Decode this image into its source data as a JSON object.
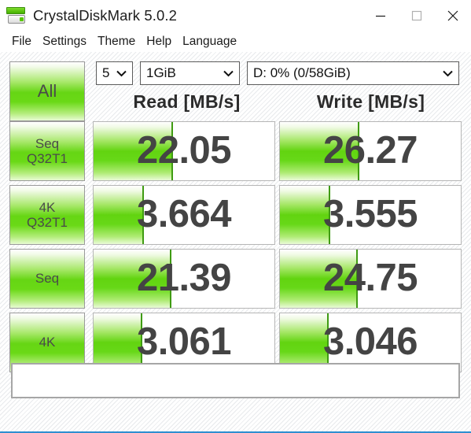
{
  "window": {
    "title": "CrystalDiskMark 5.0.2",
    "icon": "disk-icon",
    "controls": {
      "minimize": "minimize-icon",
      "maximize": "maximize-icon",
      "close": "close-icon"
    }
  },
  "menu": {
    "items": [
      {
        "label": "File"
      },
      {
        "label": "Settings"
      },
      {
        "label": "Theme"
      },
      {
        "label": "Help"
      },
      {
        "label": "Language"
      }
    ]
  },
  "settings": {
    "run_count": "5",
    "test_size": "1GiB",
    "drive": "D: 0% (0/58GiB)"
  },
  "buttons": {
    "all": "All"
  },
  "headers": {
    "read": "Read [MB/s]",
    "write": "Write [MB/s]"
  },
  "colors": {
    "bar_green": "#62d410",
    "bar_edge": "#3f9b12",
    "value_text": "#444444",
    "accent": "#2f8fd0"
  },
  "comment": {
    "value": "",
    "placeholder": ""
  },
  "chart_data": {
    "type": "bar",
    "title": "CrystalDiskMark 5.0.2 benchmark results",
    "xlabel": "",
    "ylabel": "MB/s",
    "categories": [
      "Seq Q32T1",
      "4K Q32T1",
      "Seq",
      "4K"
    ],
    "series": [
      {
        "name": "Read [MB/s]",
        "values": [
          22.05,
          3.664,
          21.39,
          3.061
        ]
      },
      {
        "name": "Write [MB/s]",
        "values": [
          26.27,
          3.555,
          24.75,
          3.046
        ]
      }
    ],
    "bar_fill_percent": {
      "read": [
        44,
        28,
        43,
        27
      ],
      "write": [
        44,
        28,
        43,
        27
      ]
    },
    "legend": "none",
    "grid": false
  },
  "rows": [
    {
      "label_line1": "Seq",
      "label_line2": "Q32T1",
      "read": {
        "value": "22.05",
        "fill": 44
      },
      "write": {
        "value": "26.27",
        "fill": 44
      }
    },
    {
      "label_line1": "4K",
      "label_line2": "Q32T1",
      "read": {
        "value": "3.664",
        "fill": 28
      },
      "write": {
        "value": "3.555",
        "fill": 28
      }
    },
    {
      "label_line1": "Seq",
      "label_line2": "",
      "read": {
        "value": "21.39",
        "fill": 43
      },
      "write": {
        "value": "24.75",
        "fill": 43
      }
    },
    {
      "label_line1": "4K",
      "label_line2": "",
      "read": {
        "value": "3.061",
        "fill": 27
      },
      "write": {
        "value": "3.046",
        "fill": 27
      }
    }
  ]
}
